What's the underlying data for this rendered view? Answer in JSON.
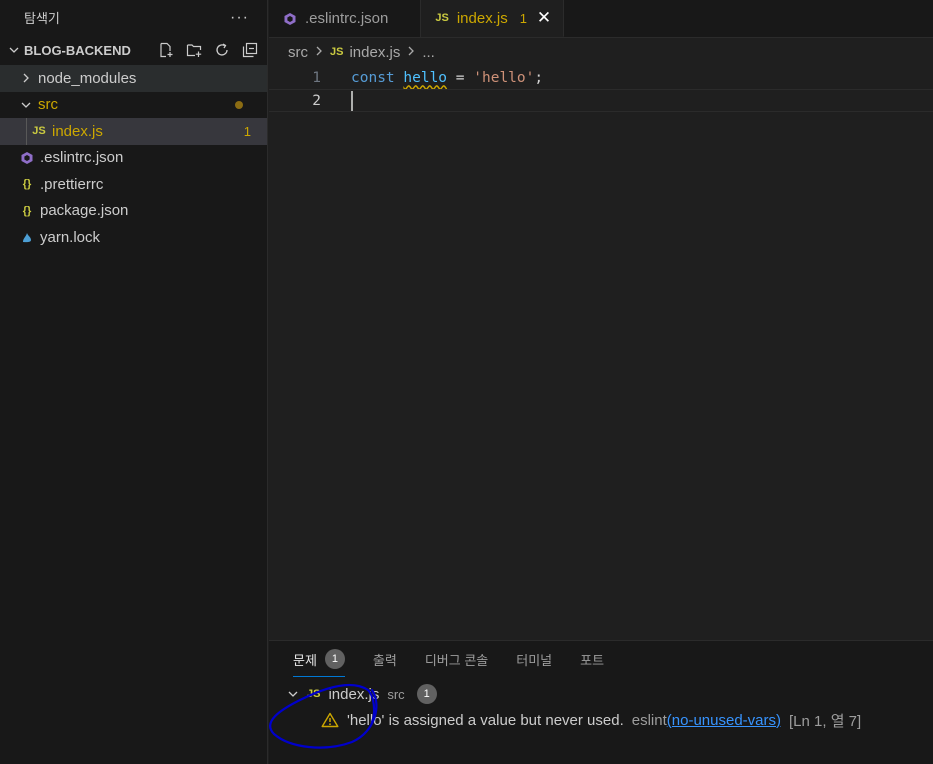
{
  "sidebar": {
    "title": "탐색기",
    "more": "···",
    "project": "BLOG-BACKEND",
    "items": [
      {
        "label": "node_modules",
        "kind": "folder",
        "expanded": false
      },
      {
        "label": "src",
        "kind": "folder",
        "expanded": true
      },
      {
        "label": "index.js",
        "kind": "js",
        "badge": "1"
      },
      {
        "label": ".eslintrc.json",
        "kind": "eslint"
      },
      {
        "label": ".prettierrc",
        "kind": "json"
      },
      {
        "label": "package.json",
        "kind": "json"
      },
      {
        "label": "yarn.lock",
        "kind": "yarn"
      }
    ]
  },
  "tabs": [
    {
      "label": ".eslintrc.json",
      "active": false
    },
    {
      "label": "index.js",
      "active": true,
      "count": "1",
      "close": "✕"
    }
  ],
  "breadcrumb": {
    "folder": "src",
    "file": "index.js",
    "ellipsis": "..."
  },
  "editor": {
    "lines": [
      {
        "number": "1",
        "keyword": "const",
        "identifier": "hello",
        "operator": " = ",
        "string": "'hello'",
        "end": ";"
      },
      {
        "number": "2"
      }
    ]
  },
  "panel": {
    "tabs": [
      {
        "label": "문제",
        "badge": "1",
        "active": true
      },
      {
        "label": "출력"
      },
      {
        "label": "디버그 콘솔"
      },
      {
        "label": "터미널"
      },
      {
        "label": "포트"
      }
    ],
    "file": {
      "name": "index.js",
      "dir": "src",
      "badge": "1"
    },
    "problem": {
      "message": "'hello' is assigned a value but never used.",
      "source": "eslint",
      "code": "(no-unused-vars)",
      "location": "[Ln 1, 열 7]"
    }
  },
  "colors": {
    "accent": "#0078d4",
    "warning": "#cca700",
    "js_icon": "#cbcb41",
    "annotation": "#0000cc"
  }
}
